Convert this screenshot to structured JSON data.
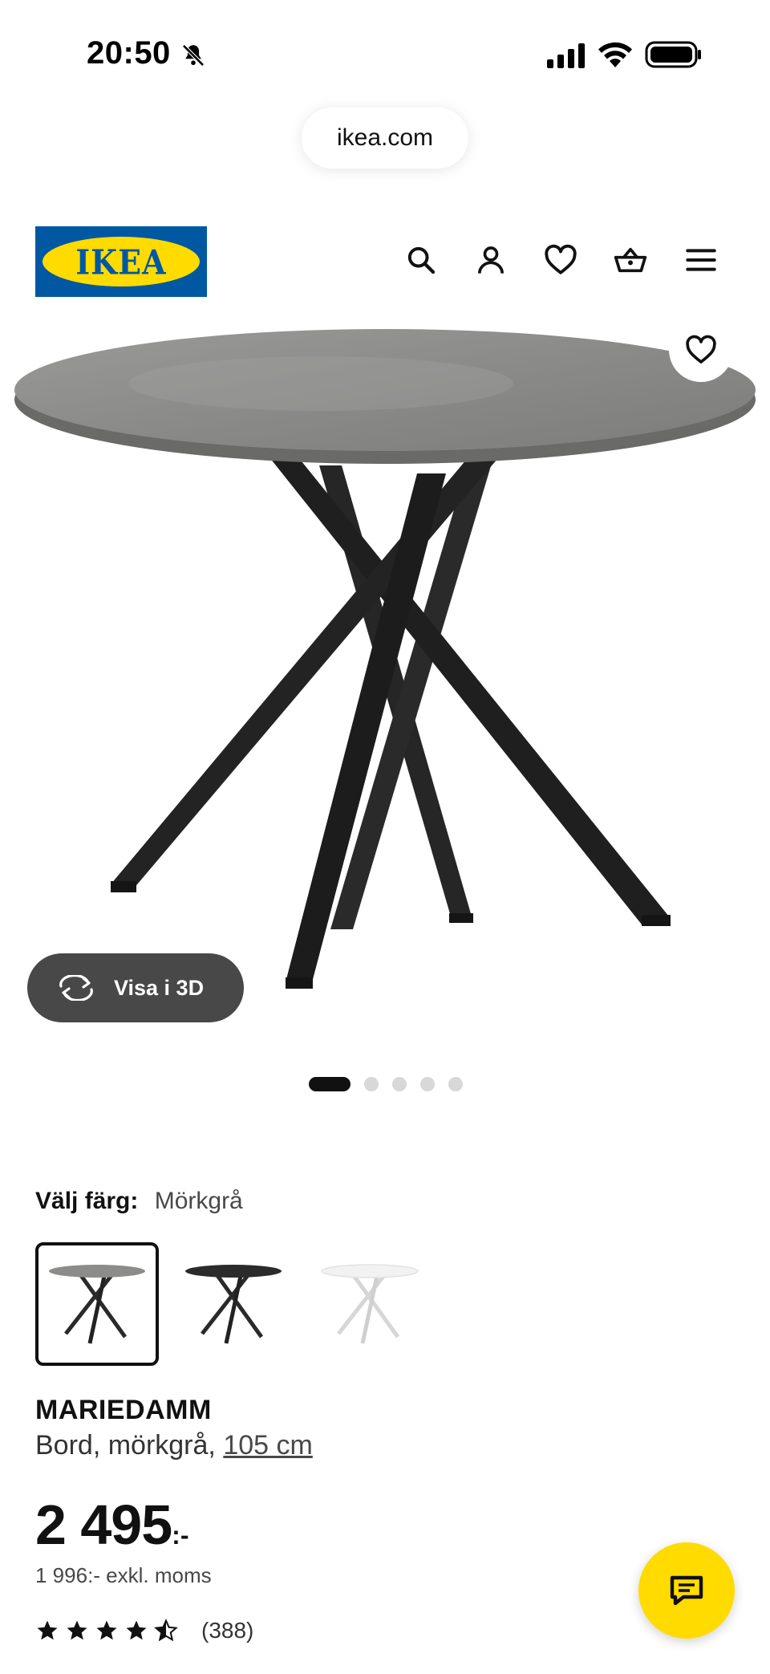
{
  "status_bar": {
    "time": "20:50",
    "icons": [
      "bell-slash-icon",
      "signal-icon",
      "wifi-icon",
      "battery-icon"
    ]
  },
  "browser": {
    "url": "ikea.com"
  },
  "header": {
    "logo_text": "IKEA",
    "icons": [
      "search-icon",
      "account-icon",
      "heart-icon",
      "basket-icon",
      "menu-icon"
    ],
    "brand_colors": {
      "blue": "#0058a3",
      "yellow": "#ffdb00"
    }
  },
  "gallery": {
    "view_3d_label": "Visa i 3D",
    "image_count": 5,
    "active_index": 0
  },
  "color_chooser": {
    "label": "Välj färg:",
    "selected": "Mörkgrå",
    "options": [
      "Mörkgrå",
      "Svart",
      "Vit"
    ]
  },
  "product": {
    "name": "MARIEDAMM",
    "desc_prefix": "Bord, mörkgrå, ",
    "size": "105 cm",
    "price_main": "2 495",
    "price_suffix": ":-",
    "price_ex_vat": "1 996:- exkl. moms",
    "rating_stars": 4.5,
    "rating_count": "(388)"
  },
  "chat": {
    "icon": "chat-icon",
    "color": "#ffdb00"
  }
}
